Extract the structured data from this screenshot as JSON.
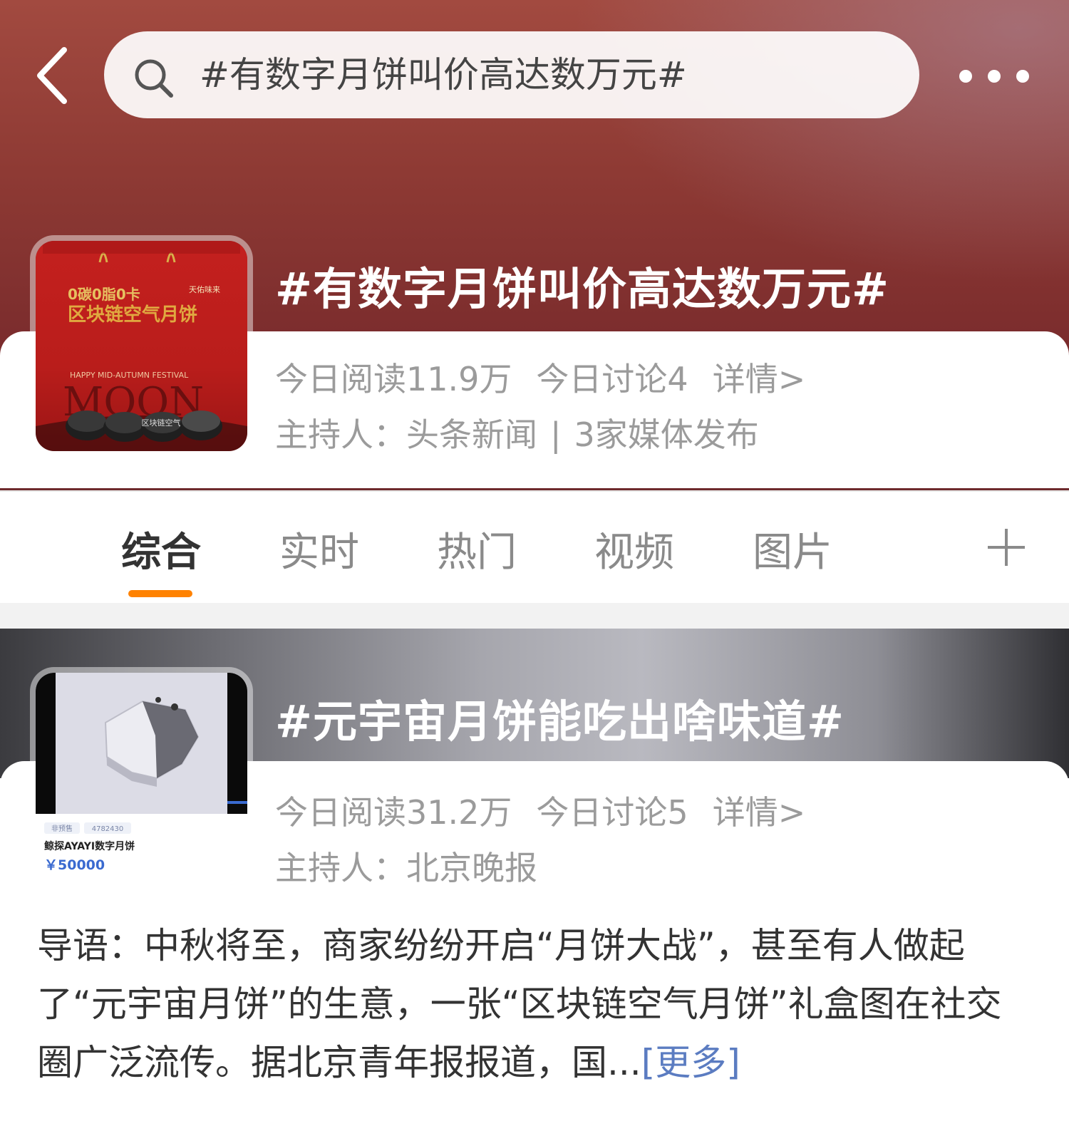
{
  "search": {
    "query": "#有数字月饼叫价高达数万元#"
  },
  "tabs": {
    "items": [
      "综合",
      "实时",
      "热门",
      "视频",
      "图片"
    ],
    "active": 0
  },
  "topics": [
    {
      "title": "#有数字月饼叫价高达数万元#",
      "reads": "今日阅读11.9万",
      "discussions": "今日讨论4",
      "detail": "详情>",
      "host_label": "主持人：",
      "host": "头条新闻",
      "media": "3家媒体发布",
      "thumb": {
        "header_left": "0碳0脂0卡",
        "header_right": "天佑味来",
        "headline": "区块链空气月饼",
        "festival": "HAPPY MID-AUTUMN FESTIVAL",
        "moon": "MOON",
        "tin_label": "区块链空气"
      }
    },
    {
      "title": "#元宇宙月饼能吃出啥味道#",
      "reads": "今日阅读31.2万",
      "discussions": "今日讨论5",
      "detail": "详情>",
      "host_label": "主持人：",
      "host": "北京晚报",
      "thumb": {
        "tag1": "非预售",
        "tag2": "4782430",
        "product": "鲸探AYAYI数字月饼",
        "price": "￥50000"
      }
    }
  ],
  "intro": {
    "text": "导语：中秋将至，商家纷纷开启“月饼大战”，甚至有人做起了“元宇宙月饼”的生意，一张“区块链空气月饼”礼盒图在社交圈广泛流传。据北京青年报报道，国...",
    "more": "[更多]"
  },
  "colors": {
    "accent": "#ff8200",
    "link": "#5b7cc1",
    "hero1": "#8e3a34",
    "text_muted": "#9b9b9b"
  }
}
